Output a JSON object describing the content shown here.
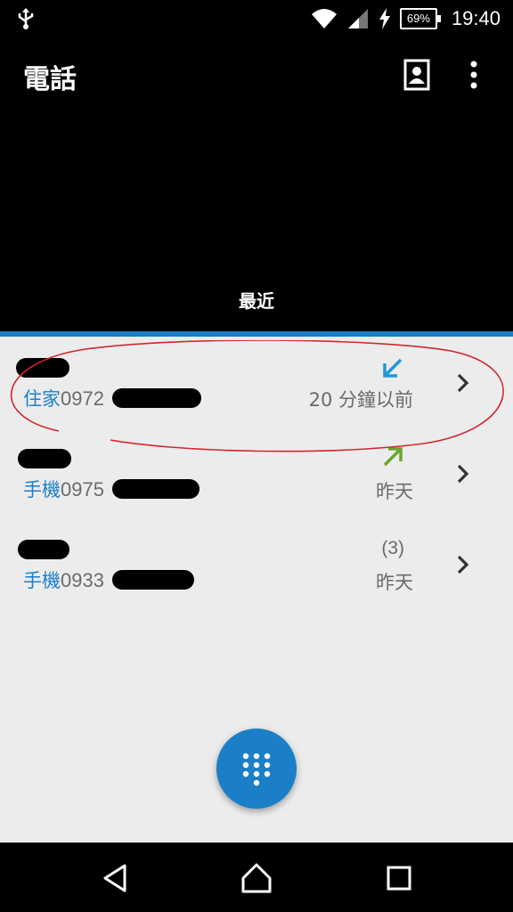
{
  "status_bar": {
    "battery": "69%",
    "time": "19:40",
    "icons": [
      "usb-icon",
      "wifi-icon",
      "signal-icon",
      "charging-icon",
      "battery-icon"
    ]
  },
  "app_bar": {
    "title": "電話",
    "icons": [
      "contacts-icon",
      "overflow-menu-icon"
    ]
  },
  "tab": {
    "label": "最近",
    "accent_color": "#1a7fc7"
  },
  "calls": [
    {
      "number_type": "住家",
      "number_prefix": "0972",
      "time": "20 分鐘以前",
      "direction": "incoming",
      "arrow_color": "#1e9ad6",
      "count": ""
    },
    {
      "number_type": "手機",
      "number_prefix": "0975",
      "time": "昨天",
      "direction": "outgoing",
      "arrow_color": "#6aa62e",
      "count": ""
    },
    {
      "number_type": "手機",
      "number_prefix": "0933",
      "time": "昨天",
      "direction": "",
      "arrow_color": "",
      "count": "(3)"
    }
  ],
  "fab": {
    "icon": "dialpad-icon"
  },
  "nav_bar": {
    "icons": [
      "back-icon",
      "home-icon",
      "recents-icon"
    ]
  }
}
